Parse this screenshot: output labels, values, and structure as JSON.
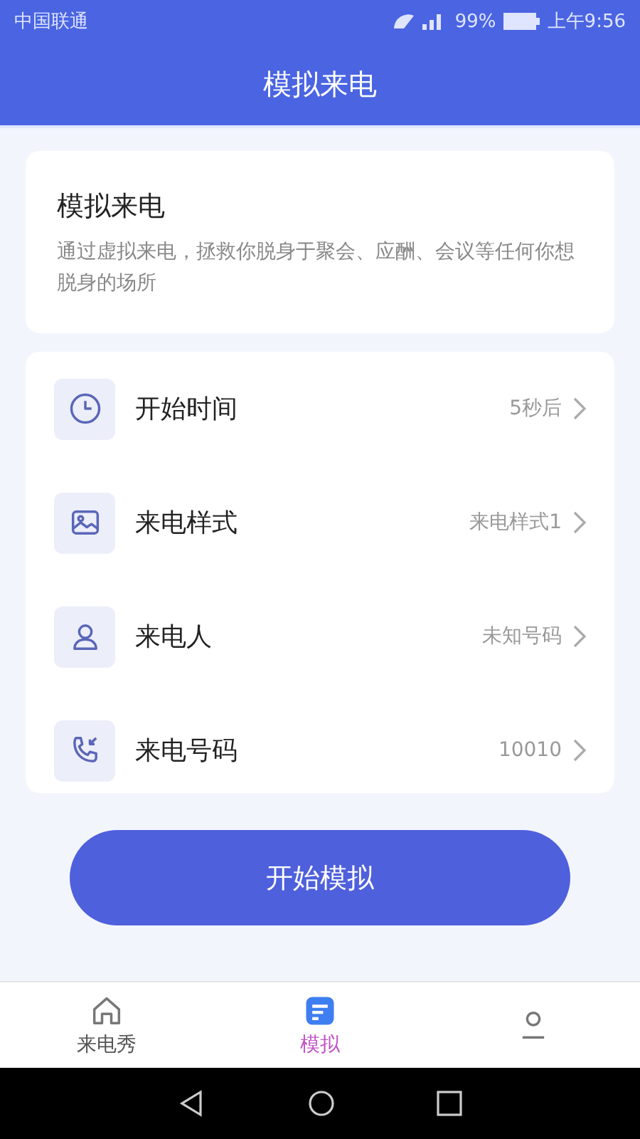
{
  "status_bar": {
    "carrier": "中国联通",
    "battery": "99%",
    "time": "上午9:56"
  },
  "header": {
    "title": "模拟来电"
  },
  "intro": {
    "title": "模拟来电",
    "description": "通过虚拟来电，拯救你脱身于聚会、应酬、会议等任何你想脱身的场所"
  },
  "settings": [
    {
      "kind": "clock",
      "label": "开始时间",
      "value": "5秒后"
    },
    {
      "kind": "image",
      "label": "来电样式",
      "value": "来电样式1"
    },
    {
      "kind": "person",
      "label": "来电人",
      "value": "未知号码"
    },
    {
      "kind": "phone",
      "label": "来电号码",
      "value": "10010"
    }
  ],
  "start_button": "开始模拟",
  "tabs": [
    {
      "kind": "home",
      "label": "来电秀",
      "selected": false
    },
    {
      "kind": "doc",
      "label": "模拟",
      "selected": true
    },
    {
      "kind": "user",
      "selected": false
    }
  ]
}
